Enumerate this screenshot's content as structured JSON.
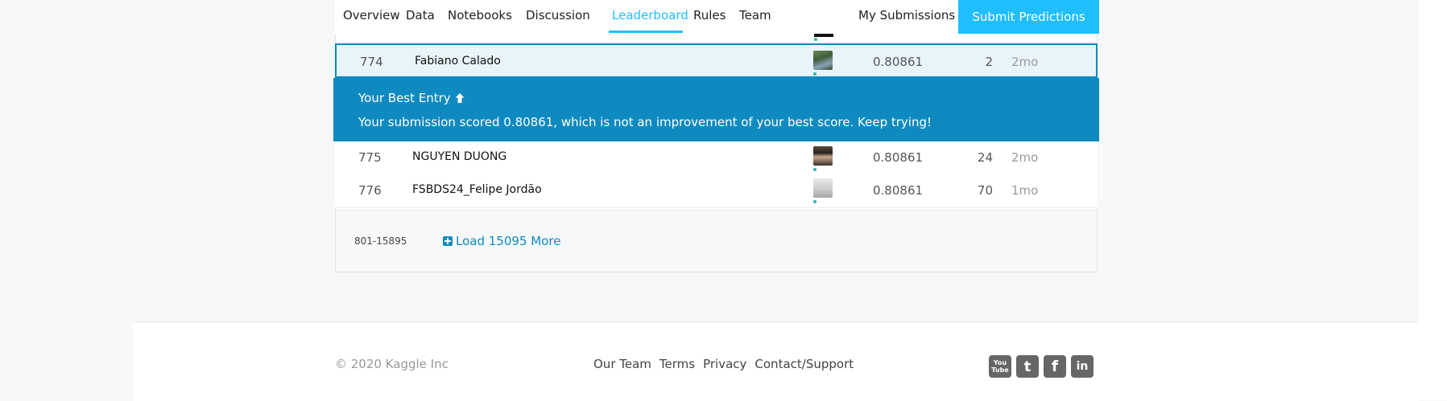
{
  "nav": {
    "tabs": [
      {
        "label": "Overview"
      },
      {
        "label": "Data"
      },
      {
        "label": "Notebooks"
      },
      {
        "label": "Discussion"
      },
      {
        "label": "Leaderboard",
        "active": true
      },
      {
        "label": "Rules"
      },
      {
        "label": "Team"
      }
    ],
    "my_submissions": "My Submissions",
    "submit_button": "Submit Predictions"
  },
  "leaderboard": {
    "rows": [
      {
        "rank": "774",
        "name": "Fabiano Calado",
        "score": "0.80861",
        "entries": "2",
        "last": "2mo",
        "mine": true
      },
      {
        "rank": "775",
        "name": "NGUYEN DUONG",
        "score": "0.80861",
        "entries": "24",
        "last": "2mo"
      },
      {
        "rank": "776",
        "name": "FSBDS24_Felipe Jordão",
        "score": "0.80861",
        "entries": "70",
        "last": "1mo"
      }
    ],
    "best_entry": {
      "title": "Your Best Entry",
      "message": "Your submission scored 0.80861, which is not an improvement of your best score. Keep trying!"
    },
    "range": "801-15895",
    "load_more": "Load 15095 More"
  },
  "footer": {
    "copyright": "© 2020 Kaggle Inc",
    "links": [
      "Our Team",
      "Terms",
      "Privacy",
      "Contact/Support"
    ],
    "social": [
      {
        "icon": "youtube-icon",
        "glyph": "You Tube"
      },
      {
        "icon": "twitter-icon",
        "glyph": "t"
      },
      {
        "icon": "facebook-icon",
        "glyph": "f"
      },
      {
        "icon": "linkedin-icon",
        "glyph": "in"
      }
    ]
  },
  "colors": {
    "accent": "#20beff",
    "highlight": "#0e8ac0"
  }
}
